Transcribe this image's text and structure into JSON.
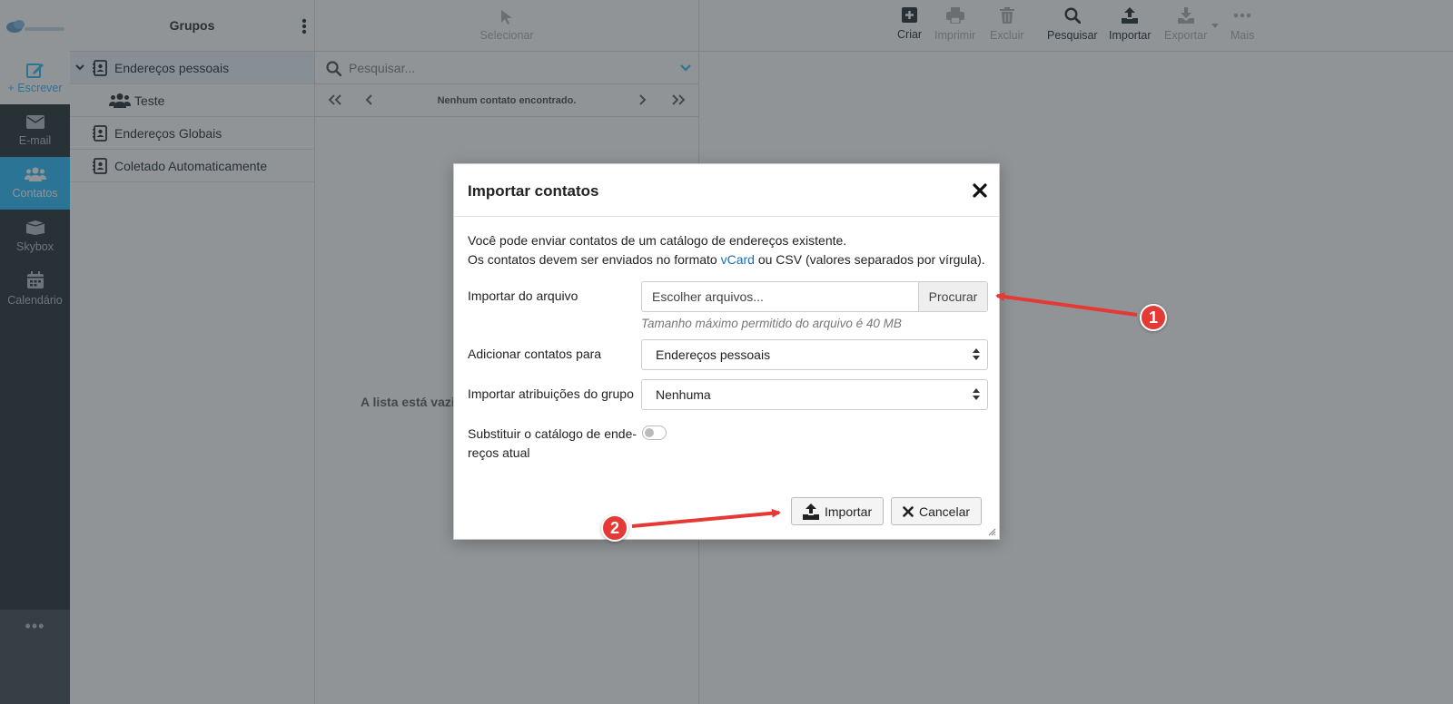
{
  "appnav": {
    "compose": "+ Escrever",
    "items": [
      {
        "label": "E-mail",
        "icon": "envelope-icon"
      },
      {
        "label": "Contatos",
        "icon": "users-icon"
      },
      {
        "label": "Skybox",
        "icon": "skybox-icon"
      },
      {
        "label": "Calendário",
        "icon": "calendar-icon"
      }
    ],
    "more": "•••"
  },
  "groups": {
    "title": "Grupos",
    "items": [
      {
        "label": "Endereços pessoais",
        "expanded": true,
        "selected": true
      },
      {
        "label": "Teste",
        "child": true
      },
      {
        "label": "Endereços Globais"
      },
      {
        "label": "Coletado Automaticamente"
      }
    ]
  },
  "list": {
    "select_label": "Selecionar",
    "search_placeholder": "Pesquisar...",
    "pager_message": "Nenhum contato encontrado.",
    "empty_message": "A lista está vazia."
  },
  "toolbar": {
    "create": "Criar",
    "print": "Imprimir",
    "delete": "Excluir",
    "search": "Pesquisar",
    "import": "Importar",
    "export": "Exportar",
    "more": "Mais"
  },
  "dialog": {
    "title": "Importar contatos",
    "intro_line1": "Você pode enviar contatos de um catálogo de endereços existente.",
    "intro_line2_pre": "Os contatos devem ser enviados no formato ",
    "intro_link": "vCard",
    "intro_line2_post": " ou CSV (valores separados por vírgula).",
    "file_label": "Importar do arquivo",
    "file_placeholder": "Escolher arquivos...",
    "browse_button": "Procurar",
    "file_hint": "Tamanho máximo permitido do arquivo é 40 MB",
    "add_to_label": "Adicionar contatos para",
    "add_to_value": "Endereços pessoais",
    "group_assign_label": "Importar atribuições do grupo",
    "group_assign_value": "Nenhuma",
    "replace_label_1": "Substituir o catálogo de ende-",
    "replace_label_2": "reços atual",
    "replace_checked": false,
    "import_button": "Importar",
    "cancel_button": "Cancelar"
  },
  "annotations": {
    "badge1": "1",
    "badge2": "2",
    "color": "#e53935"
  }
}
